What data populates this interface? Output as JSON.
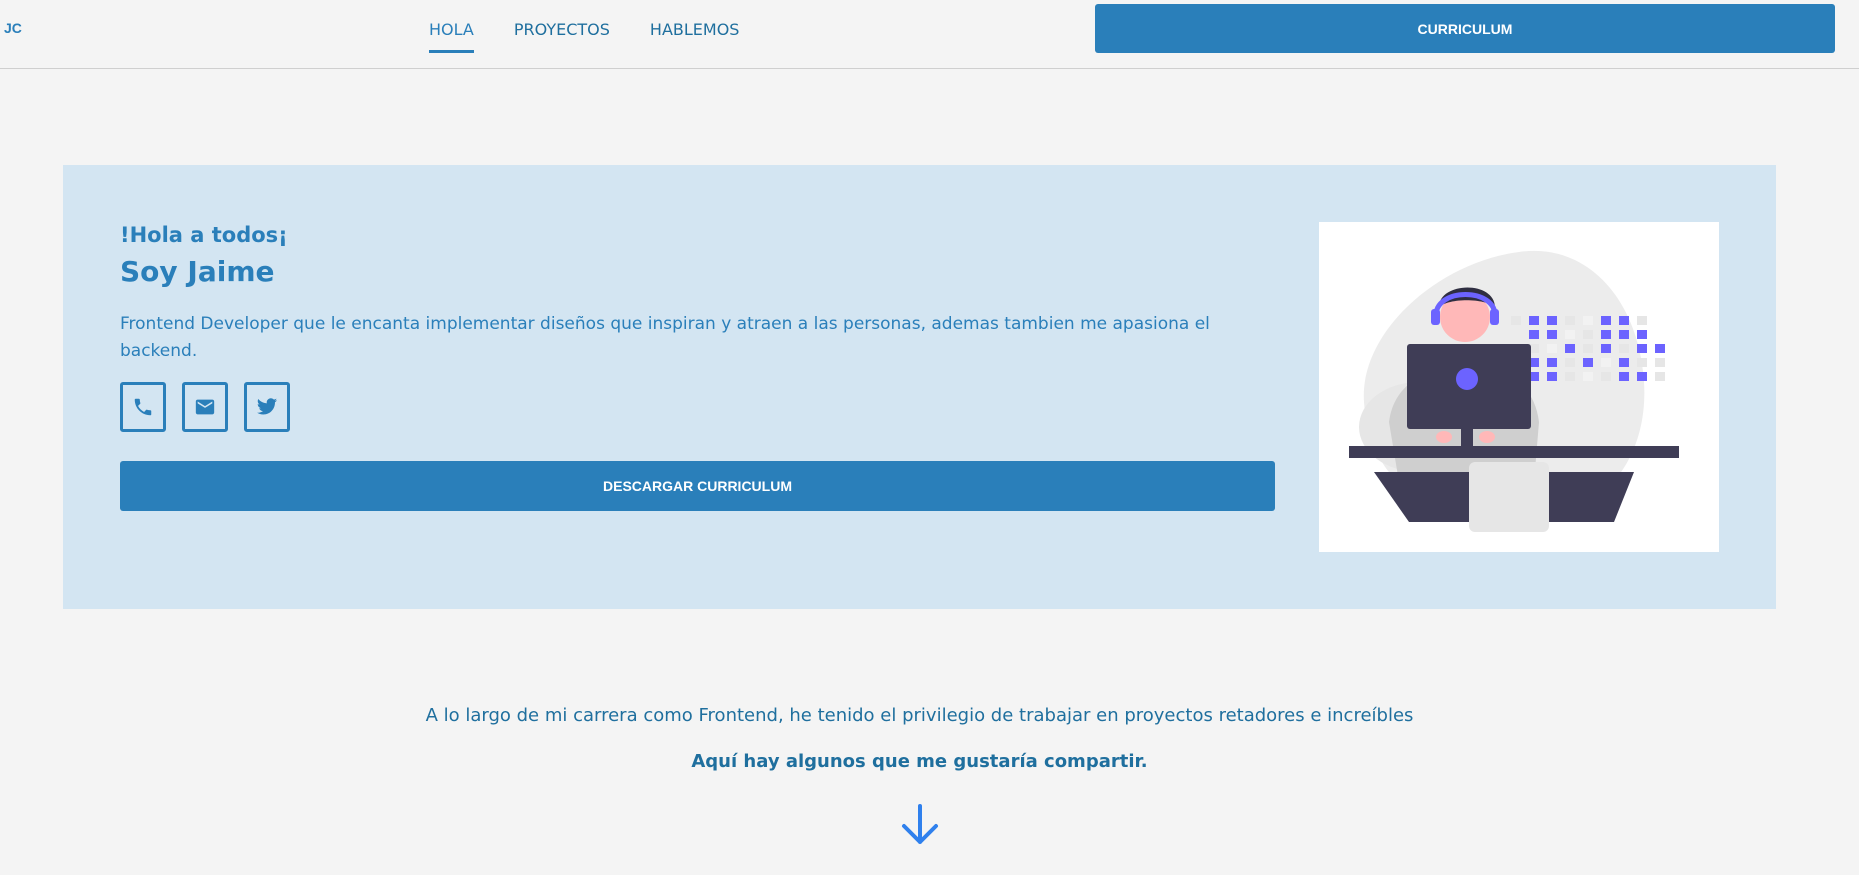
{
  "header": {
    "logo": "JC",
    "nav": [
      {
        "label": "HOLA",
        "active": true
      },
      {
        "label": "PROYECTOS",
        "active": false
      },
      {
        "label": "HABLEMOS",
        "active": false
      }
    ],
    "cv_button": "CURRICULUM"
  },
  "hero": {
    "greeting": "!Hola a todos¡",
    "name": "Soy Jaime",
    "description": "Frontend Developer que le encanta implementar diseños que inspiran y atraen a las personas, ademas tambien me apasiona el backend.",
    "socials": [
      {
        "icon": "phone-icon"
      },
      {
        "icon": "mail-icon"
      },
      {
        "icon": "twitter-icon"
      }
    ],
    "download_button": "DESCARGAR CURRICULUM"
  },
  "projects_intro": {
    "text": "A lo largo de mi carrera como Frontend, he tenido el privilegio de trabajar en proyectos retadores e increíbles",
    "highlight": "Aquí hay algunos que me gustaría compartir.",
    "arrow_icon": "arrow-down-icon"
  },
  "colors": {
    "primary": "#2a7fba",
    "hero_bg": "#d3e5f2",
    "page_bg": "#f4f4f4",
    "accent_purple": "#6c63ff"
  }
}
